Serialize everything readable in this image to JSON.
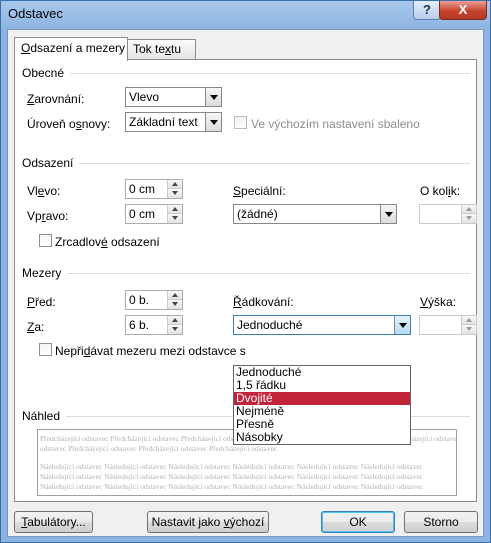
{
  "window": {
    "title": "Odstavec",
    "help_label": "?",
    "close_label": "X"
  },
  "tabs": [
    {
      "pre": "",
      "acc": "O",
      "post": "dsazení a mezery"
    },
    {
      "pre": "Tok te",
      "acc": "x",
      "post": "tu"
    }
  ],
  "obecne": {
    "heading": "Obecné",
    "zarovnani_pre": "",
    "zarovnani_acc": "Z",
    "zarovnani_post": "arovnání:",
    "zarovnani_value": "Vlevo",
    "uroven_pre": "Úroveň o",
    "uroven_acc": "s",
    "uroven_post": "novy:",
    "uroven_value": "Základní text",
    "collapse_label": "Ve výchozím nastavení sbaleno"
  },
  "odsazeni": {
    "heading": "Odsazení",
    "vlevo_pre": "Vl",
    "vlevo_acc": "e",
    "vlevo_post": "vo:",
    "vlevo_value": "0 cm",
    "vpravo_pre": "Vp",
    "vpravo_acc": "r",
    "vpravo_post": "avo:",
    "vpravo_value": "0 cm",
    "special_pre": "",
    "special_acc": "S",
    "special_post": "peciální:",
    "special_value": "(žádné)",
    "okolik_pre": "O kol",
    "okolik_acc": "i",
    "okolik_post": "k:",
    "okolik_value": "",
    "mirror_pre": "Zrcadlov",
    "mirror_acc": "é",
    "mirror_post": " odsazení"
  },
  "mezery": {
    "heading": "Mezery",
    "pred_pre": "",
    "pred_acc": "P",
    "pred_post": "řed:",
    "pred_value": "0 b.",
    "za_pre": "",
    "za_acc": "Z",
    "za_post": "a:",
    "za_value": "6 b.",
    "radkovani_pre": "",
    "radkovani_acc": "Ř",
    "radkovani_post": "ádkování:",
    "radkovani_value": "Jednoduché",
    "vyska_pre": "",
    "vyska_acc": "V",
    "vyska_post": "ýška:",
    "vyska_value": "",
    "nepridavat_pre": "Nepři",
    "nepridavat_acc": "d",
    "nepridavat_post": "ávat mezeru mezi odstavce s",
    "options": [
      "Jednoduché",
      "1,5 řádku",
      "Dvojité",
      "Nejméně",
      "Přesně",
      "Násobky"
    ],
    "selected_option": "Dvojité"
  },
  "nahled": {
    "heading": "Náhled",
    "prev_line1": "Předcházející odstavec Předcházející odstavec Předcházející odstavec Předcházející odstavec Předcházející odstavec Předcházející odstavec",
    "prev_line2": "odstavec Předcházející odstavec Předcházející odstavec Předcházející odstavec",
    "next_line1": "Následující odstavec Následující odstavec Následující odstavec Následující odstavec Následující odstavec Následující odstavec",
    "next_line2": "Následující odstavec Následující odstavec Následující odstavec Následující odstavec Následující odstavec Následující odstavec",
    "next_line3": "Následující odstavec Následující odstavec Následující odstavec Následující odstavec Následující odstavec Následující odstavec"
  },
  "buttons": {
    "tab_pre": "",
    "tab_acc": "T",
    "tab_post": "abulátory...",
    "default_pre": "Nastavit jako ",
    "default_acc": "v",
    "default_post": "ýchozí",
    "ok": "OK",
    "cancel": "Storno"
  },
  "colors": {
    "accent_selection": "#c0233a",
    "titlebar": "#8db3e2",
    "close_button": "#c7432e"
  }
}
